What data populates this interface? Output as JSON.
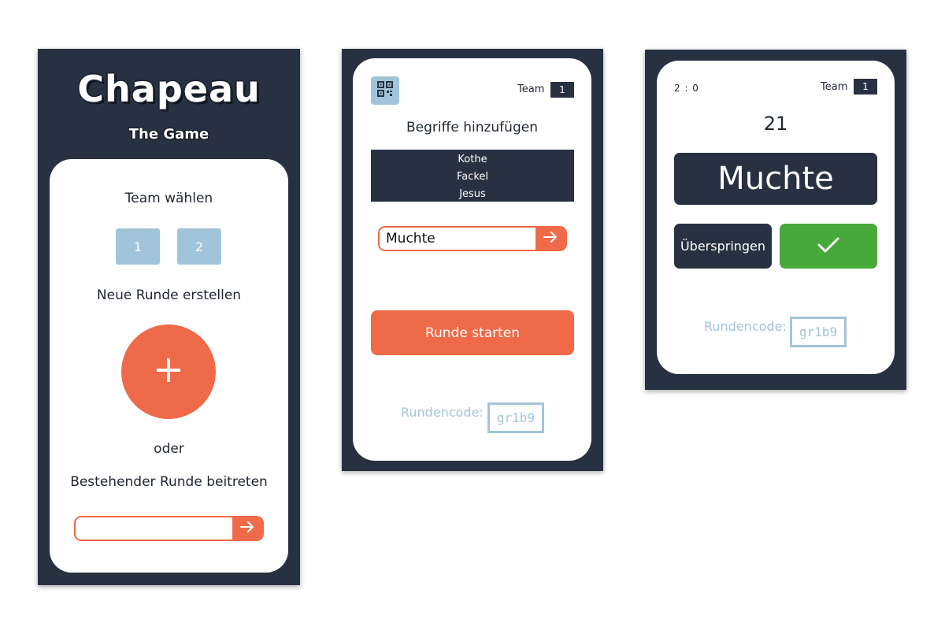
{
  "colors": {
    "navy": "#283142",
    "orange": "#ee6a48",
    "light_blue": "#a2c4db",
    "green": "#47a93a"
  },
  "screen1": {
    "title": "Chapeau",
    "subtitle": "The Game",
    "team_heading": "Team wählen",
    "team_options": [
      "1",
      "2"
    ],
    "new_round_heading": "Neue Runde erstellen",
    "create_icon": "plus-icon",
    "or_text": "oder",
    "join_heading": "Bestehender Runde beitreten",
    "join_input_value": "",
    "join_submit_icon": "arrow-right-icon"
  },
  "screen2": {
    "qr_icon": "qr-code-icon",
    "team_label": "Team",
    "team_number": "1",
    "add_terms_heading": "Begriffe hinzufügen",
    "terms": [
      "Kothe",
      "Fackel",
      "Jesus"
    ],
    "term_input_value": "Muchte",
    "submit_icon": "arrow-right-icon",
    "start_button_label": "Runde starten",
    "round_code_label": "Rundencode:",
    "round_code": "gr1b9"
  },
  "screen3": {
    "score": "2 : 0",
    "team_label": "Team",
    "team_number": "1",
    "timer": "21",
    "current_word": "Muchte",
    "skip_button_label": "Überspringen",
    "confirm_icon": "checkmark-icon",
    "round_code_label": "Rundencode:",
    "round_code": "gr1b9"
  }
}
